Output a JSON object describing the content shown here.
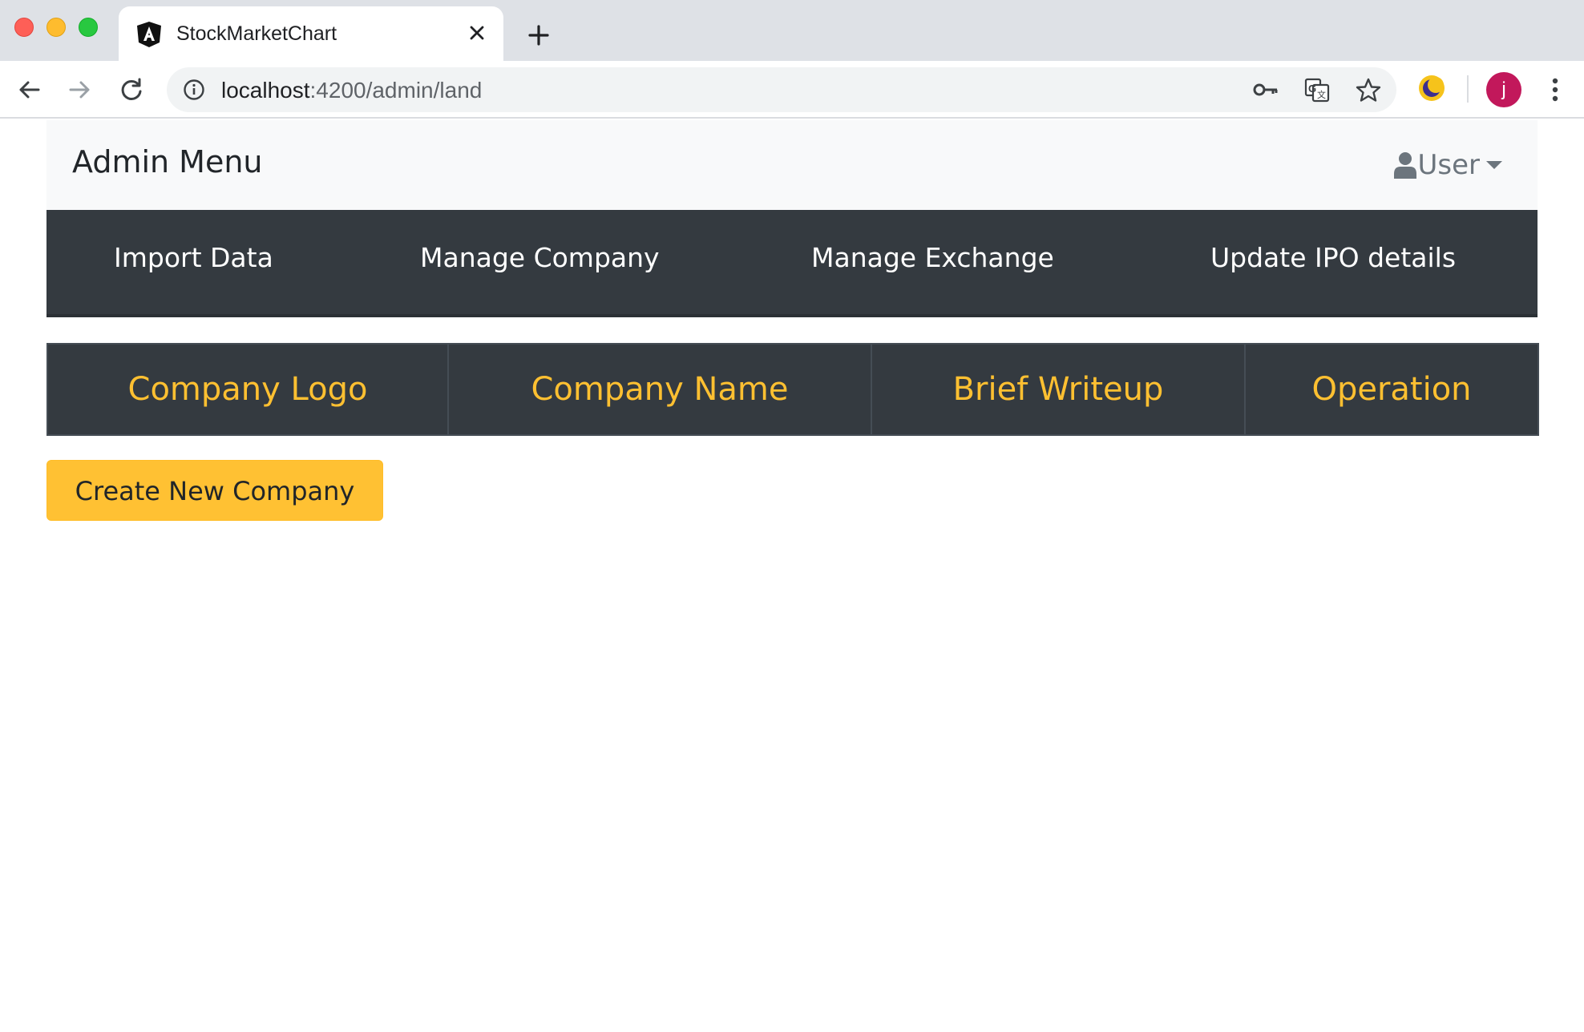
{
  "browser": {
    "tab_title": "StockMarketChart",
    "url_host": "localhost",
    "url_path": ":4200/admin/land",
    "avatar_letter": "j"
  },
  "navbar": {
    "brand": "Admin Menu",
    "user_label": "User"
  },
  "main_nav": {
    "items": [
      "Import Data",
      "Manage Company",
      "Manage Exchange",
      "Update IPO details"
    ]
  },
  "table": {
    "headers": [
      "Company Logo",
      "Company Name",
      "Brief Writeup",
      "Operation"
    ]
  },
  "actions": {
    "create_label": "Create New Company"
  },
  "colors": {
    "nav_dark": "#343a40",
    "accent_yellow": "#ffc133",
    "header_text": "#ffc031",
    "avatar": "#c2185b"
  },
  "icons": [
    "angular-favicon-icon",
    "close-icon",
    "plus-icon",
    "back-arrow-icon",
    "forward-arrow-icon",
    "reload-icon",
    "info-icon",
    "key-icon",
    "translate-icon",
    "star-icon",
    "extension-icon",
    "menu-dots-icon",
    "user-icon",
    "caret-down-icon"
  ]
}
